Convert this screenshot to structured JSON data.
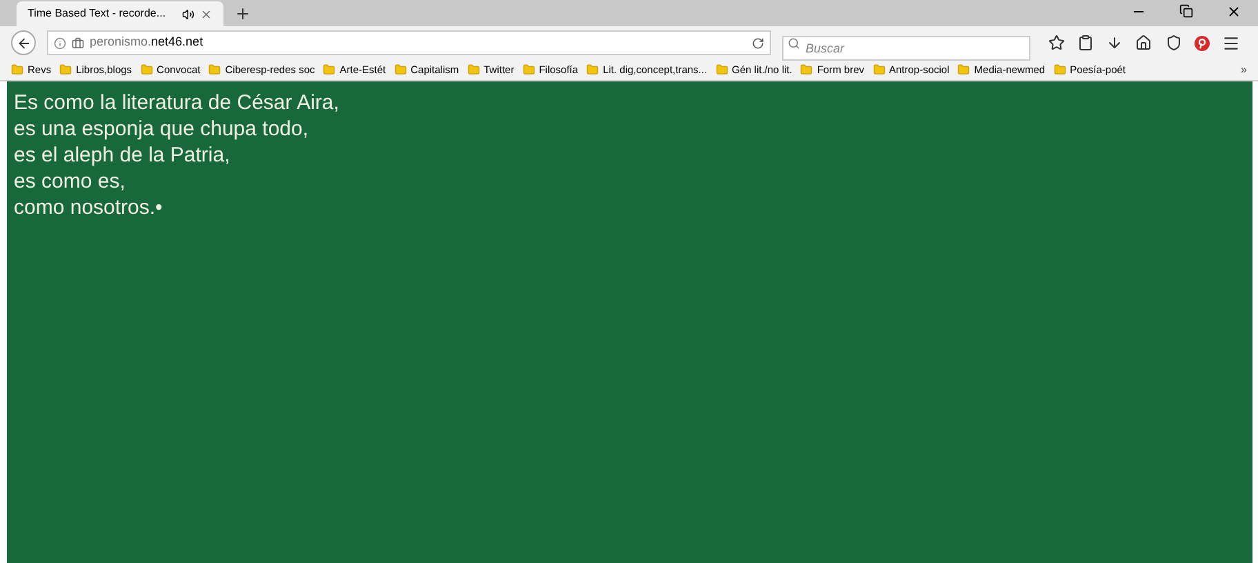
{
  "tab": {
    "title": "Time Based Text - recorde..."
  },
  "address": {
    "url": "peronismo.**net46.net**"
  },
  "search": {
    "placeholder": "Buscar"
  },
  "bookmarks": [
    "Revs",
    "Libros,blogs",
    "Convocat",
    "Ciberesp-redes soc",
    "Arte-Estét",
    "Capitalism",
    "Twitter",
    "Filosofía",
    "Lit. dig,concept,trans...",
    "Gén lit./no lit.",
    "Form brev",
    "Antrop-sociol",
    "Media-newmed",
    "Poesía-poét"
  ],
  "more_bookmarks": "»",
  "content": {
    "lines": [
      "Es como la literatura de César Aira,",
      "es una esponja que chupa todo,",
      "es el aleph de la Patria,",
      "es como es,",
      "como nosotros.•"
    ]
  }
}
